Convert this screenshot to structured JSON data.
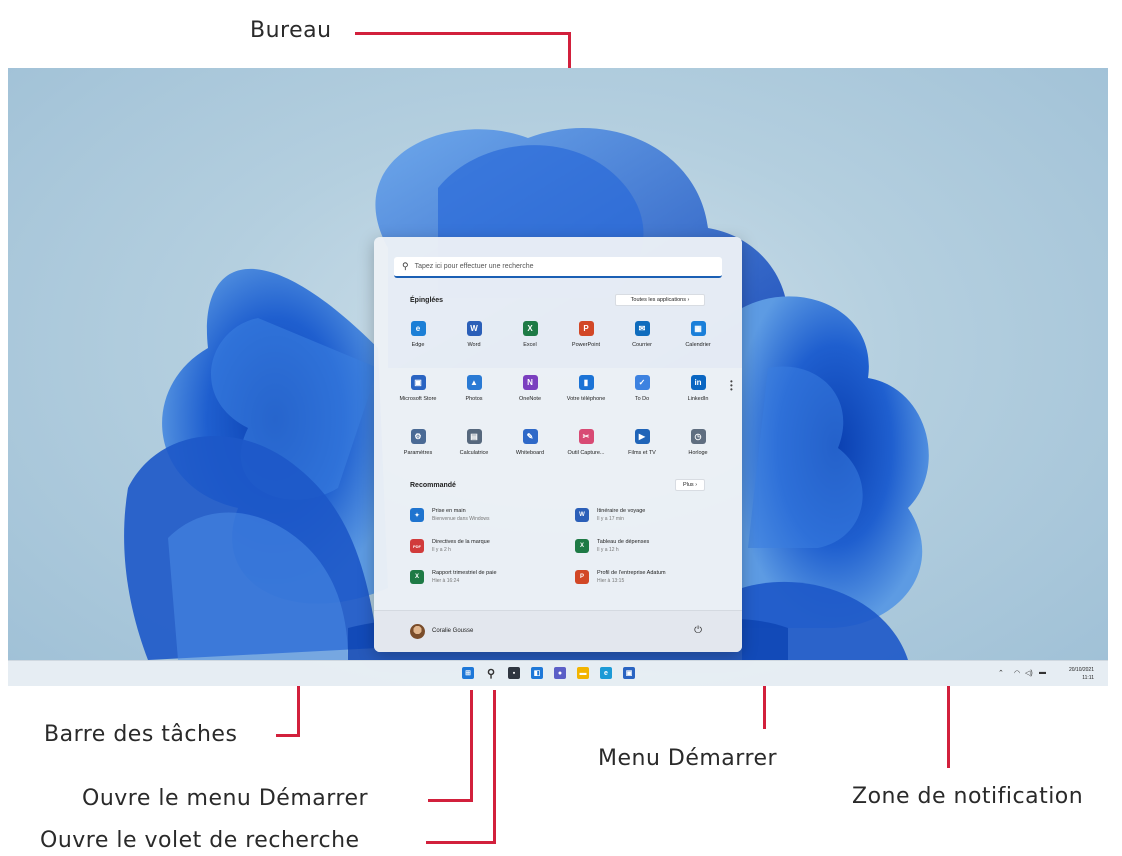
{
  "callouts": {
    "desktop": "Bureau",
    "taskbar": "Barre des tâches",
    "start_button": "Ouvre le menu Démarrer",
    "search_button": "Ouvre le volet de recherche",
    "start_menu": "Menu Démarrer",
    "notification_area": "Zone de notification"
  },
  "start_menu": {
    "search_placeholder": "Tapez ici pour effectuer une recherche",
    "pinned_title": "Épinglées",
    "all_apps_label": "Toutes les applications  ›",
    "pinned": [
      {
        "label": "Edge",
        "icon": "edge-icon",
        "color": "#1c7fd6"
      },
      {
        "label": "Word",
        "icon": "word-icon",
        "color": "#2b5fb8"
      },
      {
        "label": "Excel",
        "icon": "excel-icon",
        "color": "#1e7a45"
      },
      {
        "label": "PowerPoint",
        "icon": "powerpoint-icon",
        "color": "#d24726"
      },
      {
        "label": "Courrier",
        "icon": "mail-icon",
        "color": "#0f6cbd"
      },
      {
        "label": "Calendrier",
        "icon": "calendar-icon",
        "color": "#1a7fd9"
      },
      {
        "label": "Microsoft Store",
        "icon": "store-icon",
        "color": "#2a64c2"
      },
      {
        "label": "Photos",
        "icon": "photos-icon",
        "color": "#2a7ad4"
      },
      {
        "label": "OneNote",
        "icon": "onenote-icon",
        "color": "#7b3fbf"
      },
      {
        "label": "Votre téléphone",
        "icon": "phone-icon",
        "color": "#1b73d6"
      },
      {
        "label": "To Do",
        "icon": "todo-icon",
        "color": "#3d82e0"
      },
      {
        "label": "LinkedIn",
        "icon": "linkedin-icon",
        "color": "#0a66c2"
      },
      {
        "label": "Paramètres",
        "icon": "settings-icon",
        "color": "#4a6a95"
      },
      {
        "label": "Calculatrice",
        "icon": "calculator-icon",
        "color": "#56687d"
      },
      {
        "label": "Whiteboard",
        "icon": "whiteboard-icon",
        "color": "#2f69c8"
      },
      {
        "label": "Outil Capture...",
        "icon": "snipping-tool-icon",
        "color": "#d84a74"
      },
      {
        "label": "Films et TV",
        "icon": "films-tv-icon",
        "color": "#1f64b8"
      },
      {
        "label": "Horloge",
        "icon": "clock-icon",
        "color": "#5f6e80"
      }
    ],
    "recommended_title": "Recommandé",
    "more_label": "Plus  ›",
    "recommended": [
      {
        "title": "Prise en main",
        "subtitle": "Bienvenue dans Windows",
        "icon": "get-started-icon",
        "color": "#1f74cf"
      },
      {
        "title": "Itinéraire de voyage",
        "subtitle": "Il y a 17 min",
        "icon": "word-doc-icon",
        "color": "#2b5fb8"
      },
      {
        "title": "Directives de la marque",
        "subtitle": "Il y a 2 h",
        "icon": "pdf-icon",
        "color": "#d13b3b"
      },
      {
        "title": "Tableau de dépenses",
        "subtitle": "Il y a 12 h",
        "icon": "excel-doc-icon",
        "color": "#1e7a45"
      },
      {
        "title": "Rapport trimestriel de paie",
        "subtitle": "Hier à 16:24",
        "icon": "excel-doc-icon",
        "color": "#1e7a45"
      },
      {
        "title": "Profil de l'entreprise Adatum",
        "subtitle": "Hier à 13:15",
        "icon": "powerpoint-doc-icon",
        "color": "#d24726"
      }
    ],
    "user_name": "Coralie Gousse"
  },
  "taskbar": {
    "date": "20/10/2021",
    "time": "11:11",
    "apps": [
      {
        "icon": "start-icon",
        "color": "#1e78d8"
      },
      {
        "icon": "search-icon",
        "color": "#333333"
      },
      {
        "icon": "task-view-icon",
        "color": "#2f3640"
      },
      {
        "icon": "widgets-icon",
        "color": "#1e78d8"
      },
      {
        "icon": "chat-icon",
        "color": "#5b5fc7"
      },
      {
        "icon": "file-explorer-icon",
        "color": "#f2b400"
      },
      {
        "icon": "edge-icon",
        "color": "#1c9ad6"
      },
      {
        "icon": "store-icon",
        "color": "#2a64c2"
      }
    ]
  },
  "colors": {
    "accent_line": "#d2203c",
    "wallpaper_blue": "#1f5fcf"
  }
}
